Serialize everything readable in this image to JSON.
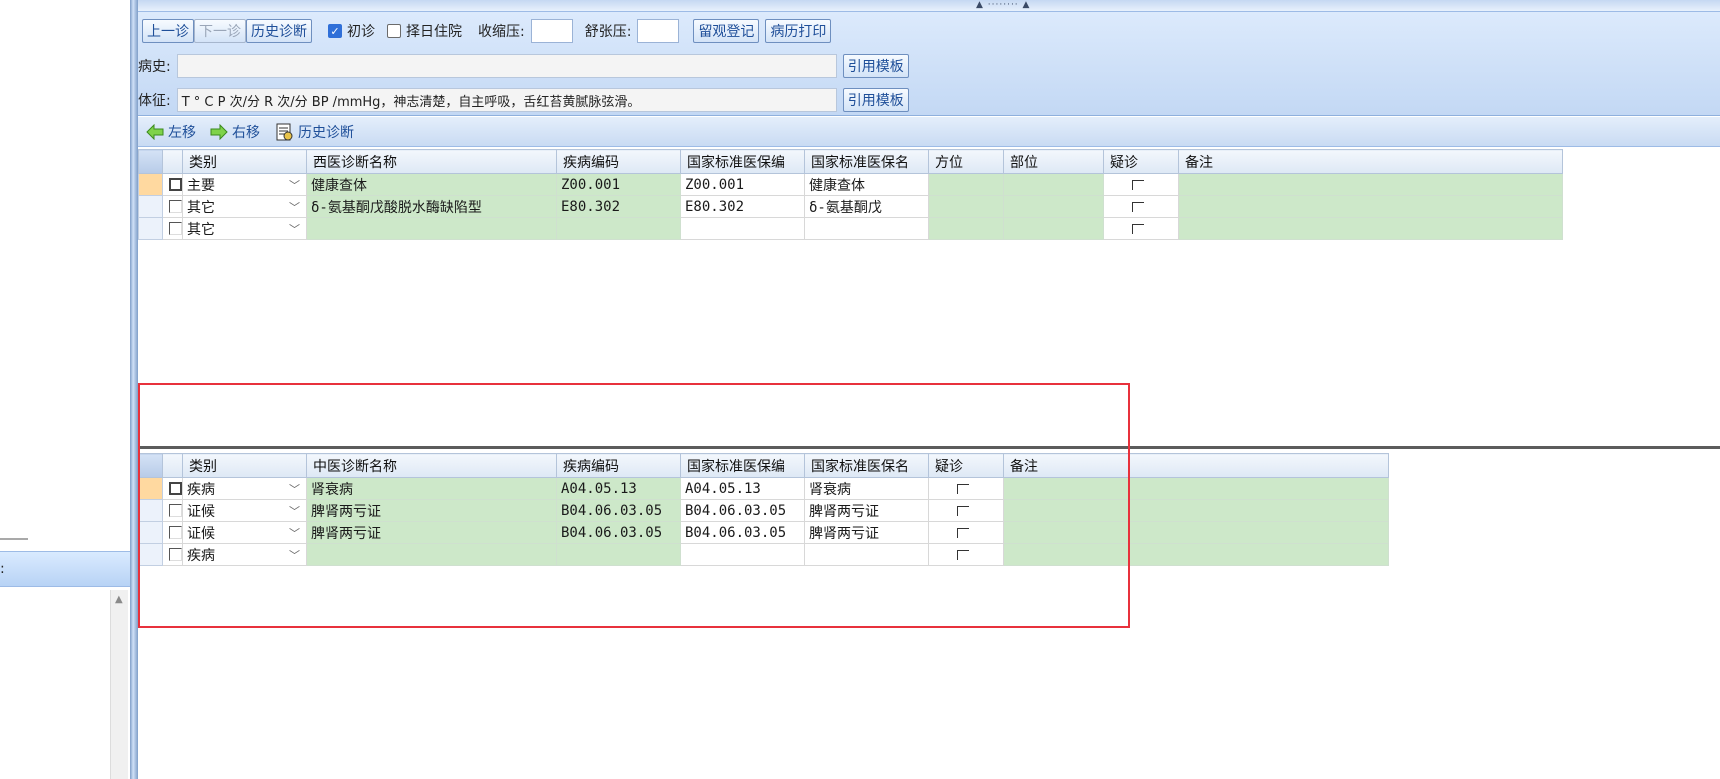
{
  "left_pane": {
    "label": ":",
    "scroll_up_icon": "up-arrow-icon"
  },
  "top_grip": {
    "mark": "▲ ········ ▲"
  },
  "toolbar": {
    "prev_visit": "上一诊",
    "next_visit": "下一诊",
    "history_diagnosis": "历史诊断",
    "first_visit_label": "初诊",
    "first_visit_checked": true,
    "select_date_admission_label": "择日住院",
    "select_date_admission_checked": false,
    "systolic_label": "收缩压:",
    "diastolic_label": "舒张压:",
    "observation_register": "留观登记",
    "print_record": "病历打印"
  },
  "history": {
    "label": "病史:",
    "value": "",
    "template_button": "引用模板"
  },
  "physical": {
    "label": "体征:",
    "value": "T  ° C   P  次/分   R  次/分  BP  /mmHg，神志清楚，自主呼吸，舌红苔黄腻脉弦滑。",
    "template_button": "引用模板"
  },
  "diag_toolbar": {
    "move_left": "左移",
    "move_right": "右移",
    "history_diagnosis": "历史诊断"
  },
  "western_grid": {
    "headers": [
      "类别",
      "西医诊断名称",
      "疾病编码",
      "国家标准医保编",
      "国家标准医保名",
      "方位",
      "部位",
      "疑诊",
      "备注"
    ],
    "rows": [
      {
        "category": "主要",
        "name": "健康查体",
        "code": "Z00.001",
        "ins_code": "Z00.001",
        "ins_name": "健康查体"
      },
      {
        "category": "其它",
        "name": "δ-氨基酮戊酸脱水酶缺陷型",
        "code": "E80.302",
        "ins_code": "E80.302",
        "ins_name": "δ-氨基酮戊"
      },
      {
        "category": "其它",
        "name": "",
        "code": "",
        "ins_code": "",
        "ins_name": ""
      }
    ]
  },
  "tcm_grid": {
    "headers": [
      "类别",
      "中医诊断名称",
      "疾病编码",
      "国家标准医保编",
      "国家标准医保名",
      "疑诊",
      "备注"
    ],
    "rows": [
      {
        "category": "疾病",
        "name": "肾衰病",
        "code": "A04.05.13",
        "ins_code": "A04.05.13",
        "ins_name": "肾衰病"
      },
      {
        "category": "证候",
        "name": "脾肾两亏证",
        "code": "B04.06.03.05",
        "ins_code": "B04.06.03.05",
        "ins_name": "脾肾两亏证"
      },
      {
        "category": "证候",
        "name": "脾肾两亏证",
        "code": "B04.06.03.05",
        "ins_code": "B04.06.03.05",
        "ins_name": "脾肾两亏证"
      },
      {
        "category": "疾病",
        "name": "",
        "code": "",
        "ins_code": "",
        "ins_name": ""
      }
    ]
  },
  "colors": {
    "row_green": "#cde8c9",
    "current_row": "#ffd9a0",
    "highlight_box": "#e8313c",
    "toolbar_blue": "#c3d8f4"
  }
}
